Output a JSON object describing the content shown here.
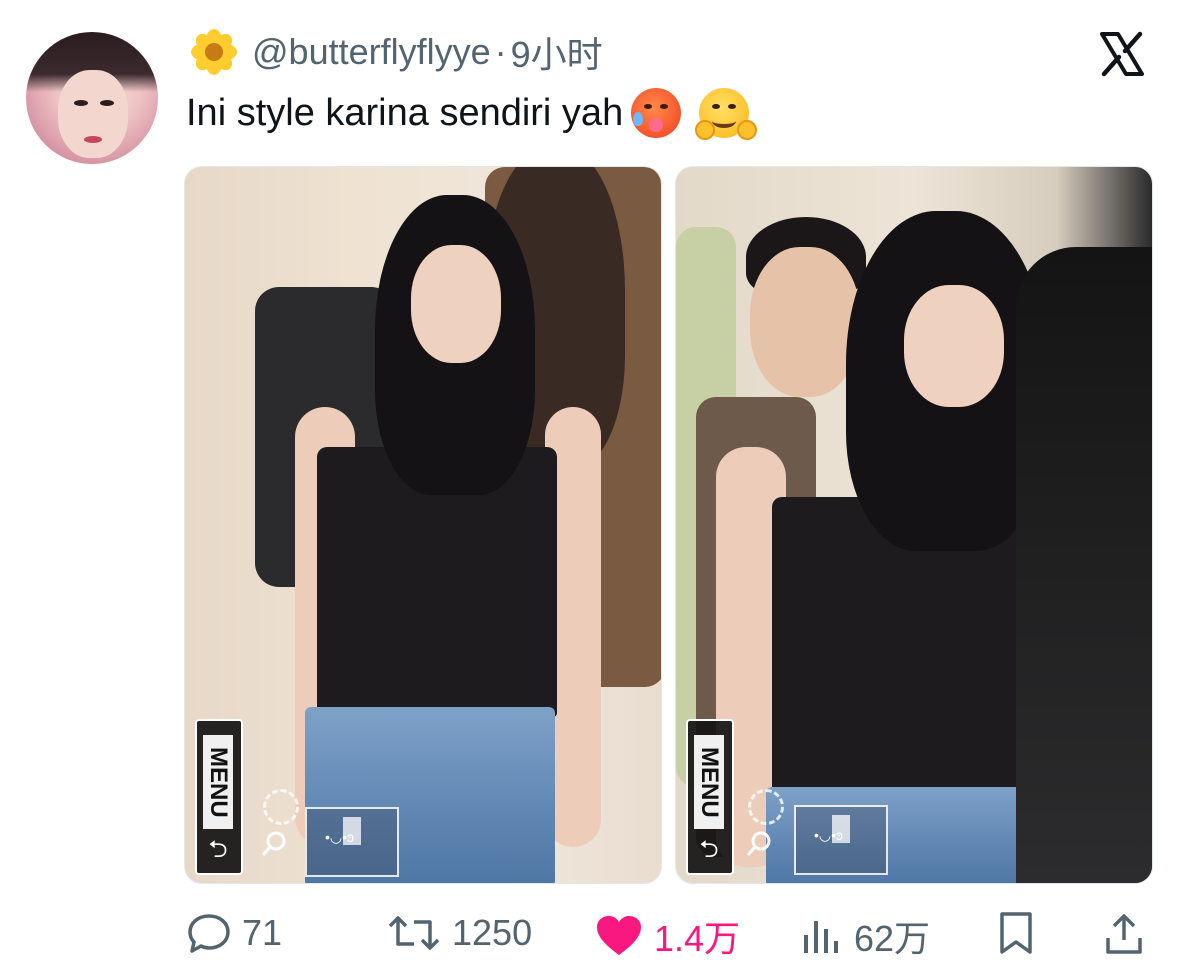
{
  "tweet": {
    "handle": "@butterflyflyye",
    "separator": "·",
    "time": "9小时",
    "text": "Ini style karina sendiri yah",
    "emojis": [
      "hot-face-emoji",
      "hugging-face-emoji"
    ],
    "name_emoji": "sunflower-icon"
  },
  "photos": {
    "left": {
      "overlay_menu": "MENU",
      "overlay_undo": "⮌",
      "overlay_tag": "•◡•ͽ"
    },
    "right": {
      "overlay_menu": "MENU",
      "overlay_undo": "⮌",
      "overlay_tag": "•◡•ͽ"
    }
  },
  "actions": {
    "replies": "71",
    "retweets": "1250",
    "likes": "1.4万",
    "views": "62万"
  },
  "colors": {
    "like": "#f91880",
    "muted": "#536471",
    "text": "#0f1419"
  }
}
